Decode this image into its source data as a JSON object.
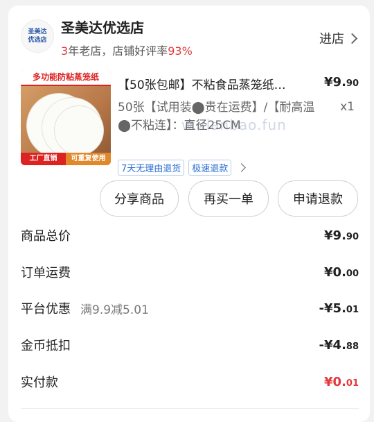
{
  "store": {
    "logo_line1": "圣美达",
    "logo_line2": "优选店",
    "name": "圣美达优选店",
    "years": "3",
    "meta_text": "年老店，店铺好评率",
    "rating": "93%",
    "enter_label": "进店"
  },
  "product": {
    "image_banner": "多功能防粘蒸笼纸",
    "image_footer_left": "工厂直销",
    "image_footer_right": "可重复使用",
    "title": "【50张包邮】不粘食品蒸笼纸…",
    "price_int": "¥9.",
    "price_dec": "90",
    "spec": "50张【试用装⬤贵在运费】/【耐高温⬤不粘连】：直径25CM",
    "qty": "x1",
    "tags": [
      "7天无理由退货",
      "极速退款"
    ]
  },
  "watermark": "w.xianbao.fun",
  "buttons": {
    "share": "分享商品",
    "rebuy": "再买一单",
    "refund": "申请退款"
  },
  "summary": {
    "total_label": "商品总价",
    "total_int": "¥9.",
    "total_dec": "90",
    "shipping_label": "订单运费",
    "shipping_int": "¥0.",
    "shipping_dec": "00",
    "discount_label": "平台优惠",
    "discount_note": "满9.9减5.01",
    "discount_int": "-¥5.",
    "discount_dec": "01",
    "coin_label": "金币抵扣",
    "coin_int": "-¥4.",
    "coin_dec": "88",
    "paid_label": "实付款",
    "paid_int": "¥0.",
    "paid_dec": "01"
  },
  "colors": {
    "accent_red": "#e4393c",
    "tag_blue": "#2a6ed1"
  }
}
